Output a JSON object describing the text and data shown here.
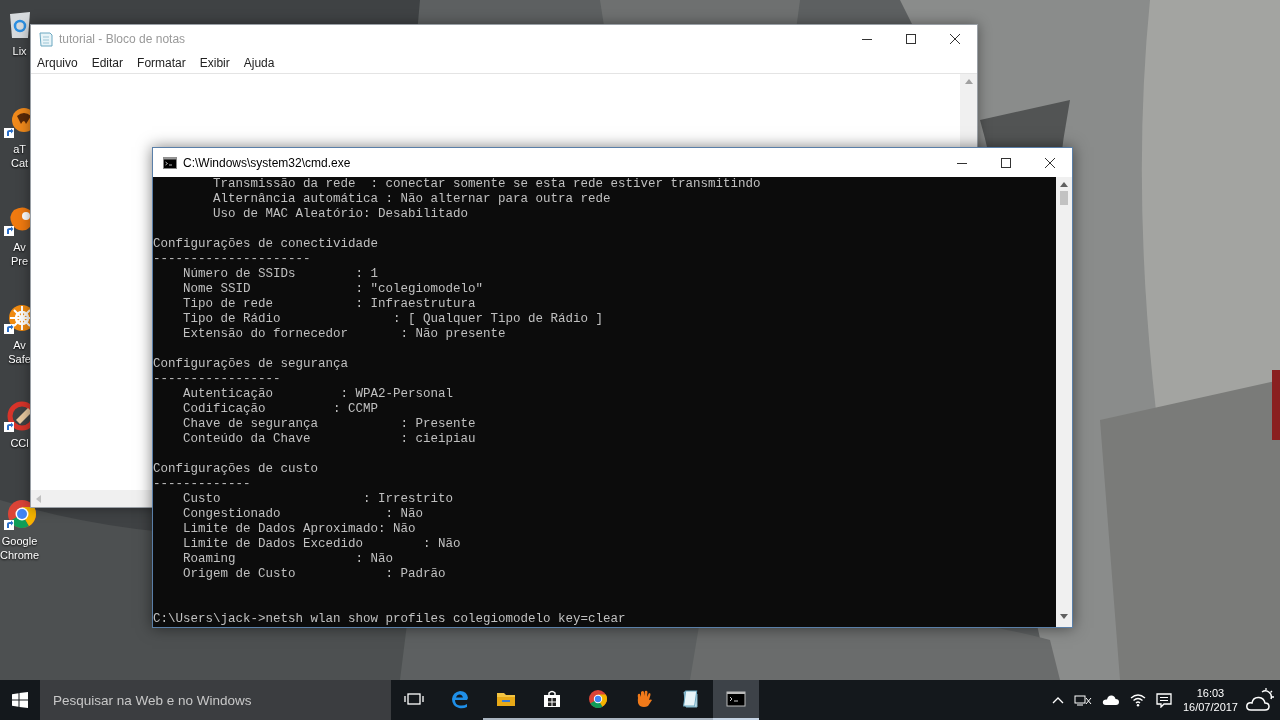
{
  "desktop_icons": [
    {
      "kind": "recycle",
      "label": [
        "Lix"
      ]
    },
    {
      "kind": "atube",
      "label": [
        "aT",
        "Cat"
      ]
    },
    {
      "kind": "avast",
      "label": [
        "Av",
        "Pre"
      ]
    },
    {
      "kind": "safezone",
      "label": [
        "Av",
        "Safe"
      ]
    },
    {
      "kind": "ccleaner",
      "label": [
        "CCl"
      ]
    },
    {
      "kind": "chrome",
      "label": [
        "Google",
        "Chrome"
      ]
    }
  ],
  "notepad": {
    "title": "tutorial - Bloco de notas",
    "menu": [
      "Arquivo",
      "Editar",
      "Formatar",
      "Exibir",
      "Ajuda"
    ]
  },
  "console": {
    "title": "C:\\Windows\\system32\\cmd.exe",
    "blocks": [
      [
        "        Transmissão da rede  : conectar somente se esta rede estiver transmitindo",
        "        Alternância automática : Não alternar para outra rede",
        "        Uso de MAC Aleatório: Desabilitado"
      ],
      [
        "Configurações de conectividade",
        "---------------------",
        "    Número de SSIDs        : 1",
        "    Nome SSID              : \"colegiomodelo\"",
        "    Tipo de rede           : Infraestrutura",
        "    Tipo de Rádio               : [ Qualquer Tipo de Rádio ]",
        "    Extensão do fornecedor       : Não presente"
      ],
      [
        "Configurações de segurança",
        "-----------------",
        "    Autenticação         : WPA2-Personal",
        "    Codificação         : CCMP",
        "    Chave de segurança           : Presente",
        "    Conteúdo da Chave            : cieipiau"
      ],
      [
        "Configurações de custo",
        "-------------",
        "    Custo                   : Irrestrito",
        "    Congestionado              : Não",
        "    Limite de Dados Aproximado: Não",
        "    Limite de Dados Excedido        : Não",
        "    Roaming                : Não",
        "    Origem de Custo            : Padrão"
      ]
    ],
    "prompt": "C:\\Users\\jack->netsh wlan show profiles colegiomodelo key=clear"
  },
  "taskbar": {
    "search": {
      "placeholder": "Pesquisar na Web e no Windows"
    },
    "apps": [
      {
        "kind": "taskview",
        "running": false,
        "selected": false
      },
      {
        "kind": "edge",
        "running": false,
        "selected": false
      },
      {
        "kind": "explorer",
        "running": true,
        "selected": false
      },
      {
        "kind": "store",
        "running": true,
        "selected": false
      },
      {
        "kind": "chrome",
        "running": true,
        "selected": false
      },
      {
        "kind": "hand",
        "running": true,
        "selected": false
      },
      {
        "kind": "notepad",
        "running": true,
        "selected": false
      },
      {
        "kind": "cmd",
        "running": true,
        "selected": true
      }
    ],
    "time": "16:03",
    "date": "16/07/2017"
  }
}
